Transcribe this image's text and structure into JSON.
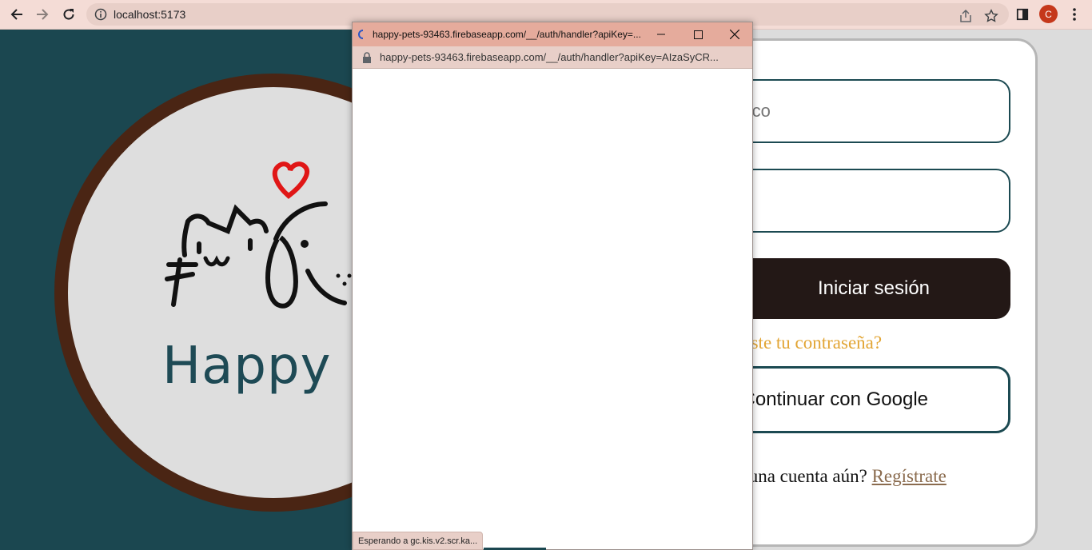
{
  "browser": {
    "url": "localhost:5173",
    "profile_initial": "C",
    "icons": [
      "back-arrow-icon",
      "forward-arrow-icon",
      "reload-icon",
      "info-icon",
      "share-icon",
      "star-icon",
      "side-panel-icon",
      "kebab-menu-icon"
    ]
  },
  "left": {
    "brand": "Happy Pe"
  },
  "form": {
    "email_placeholder": "rónico",
    "password_placeholder": "",
    "login_label": "Iniciar sesión",
    "forgot_label": "vidaste tu contraseña?",
    "google_label": "Continuar con Google",
    "signup_prompt": "s una cuenta aún?",
    "signup_link": "Regístrate"
  },
  "popup": {
    "title": "happy-pets-93463.firebaseapp.com/__/auth/handler?apiKey=...",
    "address": "happy-pets-93463.firebaseapp.com/__/auth/handler?apiKey=AIzaSyCR...",
    "status": "Esperando a gc.kis.v2.scr.ka..."
  },
  "colors": {
    "page_bg": "#1b4750",
    "chrome_bg": "#f4dcd6",
    "popup_title_bg": "#e5ab9c",
    "login_btn": "#231816",
    "forgot_link": "#e2a534",
    "signup_link": "#8a6b4e",
    "heart": "#e01616"
  }
}
